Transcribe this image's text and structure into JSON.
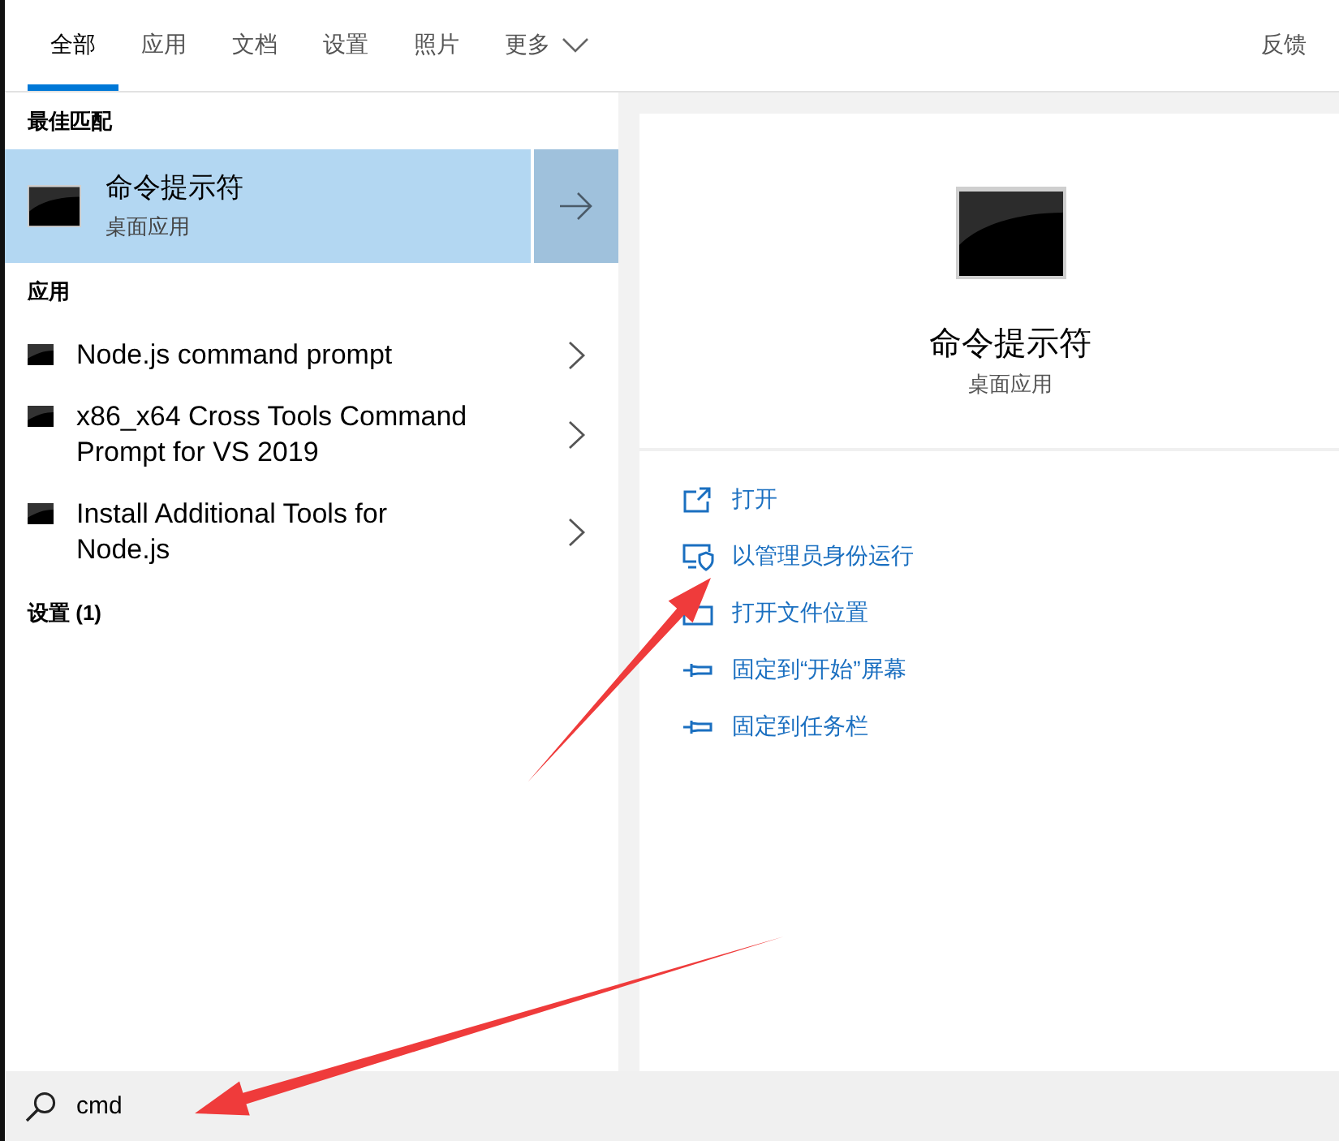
{
  "tabs": [
    {
      "label": "全部",
      "kind": "tab",
      "selected": true
    },
    {
      "label": "应用",
      "kind": "tab",
      "selected": false
    },
    {
      "label": "文档",
      "kind": "tab",
      "selected": false
    },
    {
      "label": "设置",
      "kind": "tab",
      "selected": false
    },
    {
      "label": "照片",
      "kind": "tab",
      "selected": false
    },
    {
      "label": "更多",
      "kind": "dropdown",
      "selected": false
    }
  ],
  "feedback": "反馈",
  "best_match": {
    "heading": "最佳匹配",
    "title": "命令提示符",
    "subtitle": "桌面应用",
    "selected": true
  },
  "apps": {
    "heading": "应用",
    "items": [
      {
        "name": "Node.js command prompt"
      },
      {
        "name": "x86_x64 Cross Tools Command Prompt for VS 2019"
      },
      {
        "name": "Install Additional Tools for Node.js"
      }
    ]
  },
  "settings": {
    "heading": "设置 (1)"
  },
  "details": {
    "title": "命令提示符",
    "subtitle": "桌面应用",
    "actions": [
      {
        "label": "打开",
        "kind": "open"
      },
      {
        "label": "以管理员身份运行",
        "kind": "admin"
      },
      {
        "label": "打开文件位置",
        "kind": "folder"
      },
      {
        "label": "固定到“开始”屏幕",
        "kind": "pin"
      },
      {
        "label": "固定到任务栏",
        "kind": "pin"
      }
    ]
  },
  "search": {
    "value": "cmd"
  }
}
